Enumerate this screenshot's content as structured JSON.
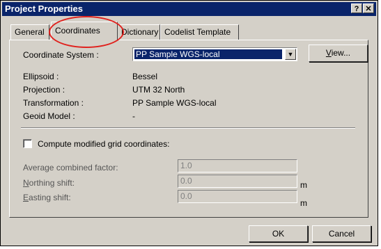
{
  "window": {
    "title": "Project Properties",
    "help_glyph": "?",
    "close_glyph": "✕"
  },
  "tabs": [
    {
      "label": "General",
      "active": false
    },
    {
      "label": "Coordinates",
      "active": true
    },
    {
      "label": "Dictionary",
      "active": false
    },
    {
      "label": "Codelist Template",
      "active": false
    }
  ],
  "coordinate_system": {
    "label": "Coordinate System  :",
    "value": "PP Sample WGS-local",
    "view_button": "View..."
  },
  "info": [
    {
      "label": "Ellipsoid :",
      "value": "Bessel"
    },
    {
      "label": "Projection :",
      "value": "UTM 32 North"
    },
    {
      "label": "Transformation :",
      "value": "PP Sample WGS-local"
    },
    {
      "label": "Geoid Model :",
      "value": "-"
    }
  ],
  "modified_grid": {
    "checkbox_label": "Compute modified grid coordinates:",
    "checked": false,
    "average_factor": {
      "label": "Average combined factor:",
      "value": "1.0"
    },
    "northing": {
      "label": "Northing shift:",
      "value": "0.0",
      "unit": "m"
    },
    "easting": {
      "label": "Easting shift:",
      "value": "0.0",
      "unit": "m"
    }
  },
  "buttons": {
    "ok": "OK",
    "cancel": "Cancel"
  },
  "colors": {
    "titlebar": "#0a246a",
    "dialog": "#d4d0c8",
    "highlight_circle": "#e0201c"
  }
}
